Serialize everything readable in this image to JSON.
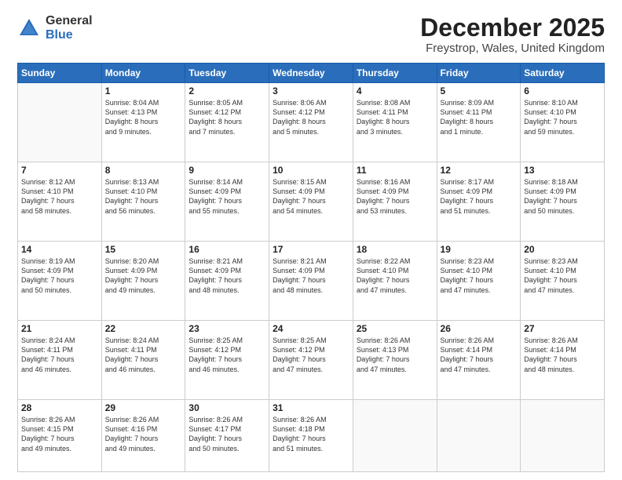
{
  "logo": {
    "general": "General",
    "blue": "Blue"
  },
  "header": {
    "month": "December 2025",
    "location": "Freystrop, Wales, United Kingdom"
  },
  "weekdays": [
    "Sunday",
    "Monday",
    "Tuesday",
    "Wednesday",
    "Thursday",
    "Friday",
    "Saturday"
  ],
  "weeks": [
    [
      {
        "day": "",
        "info": ""
      },
      {
        "day": "1",
        "info": "Sunrise: 8:04 AM\nSunset: 4:13 PM\nDaylight: 8 hours\nand 9 minutes."
      },
      {
        "day": "2",
        "info": "Sunrise: 8:05 AM\nSunset: 4:12 PM\nDaylight: 8 hours\nand 7 minutes."
      },
      {
        "day": "3",
        "info": "Sunrise: 8:06 AM\nSunset: 4:12 PM\nDaylight: 8 hours\nand 5 minutes."
      },
      {
        "day": "4",
        "info": "Sunrise: 8:08 AM\nSunset: 4:11 PM\nDaylight: 8 hours\nand 3 minutes."
      },
      {
        "day": "5",
        "info": "Sunrise: 8:09 AM\nSunset: 4:11 PM\nDaylight: 8 hours\nand 1 minute."
      },
      {
        "day": "6",
        "info": "Sunrise: 8:10 AM\nSunset: 4:10 PM\nDaylight: 7 hours\nand 59 minutes."
      }
    ],
    [
      {
        "day": "7",
        "info": "Sunrise: 8:12 AM\nSunset: 4:10 PM\nDaylight: 7 hours\nand 58 minutes."
      },
      {
        "day": "8",
        "info": "Sunrise: 8:13 AM\nSunset: 4:10 PM\nDaylight: 7 hours\nand 56 minutes."
      },
      {
        "day": "9",
        "info": "Sunrise: 8:14 AM\nSunset: 4:09 PM\nDaylight: 7 hours\nand 55 minutes."
      },
      {
        "day": "10",
        "info": "Sunrise: 8:15 AM\nSunset: 4:09 PM\nDaylight: 7 hours\nand 54 minutes."
      },
      {
        "day": "11",
        "info": "Sunrise: 8:16 AM\nSunset: 4:09 PM\nDaylight: 7 hours\nand 53 minutes."
      },
      {
        "day": "12",
        "info": "Sunrise: 8:17 AM\nSunset: 4:09 PM\nDaylight: 7 hours\nand 51 minutes."
      },
      {
        "day": "13",
        "info": "Sunrise: 8:18 AM\nSunset: 4:09 PM\nDaylight: 7 hours\nand 50 minutes."
      }
    ],
    [
      {
        "day": "14",
        "info": "Sunrise: 8:19 AM\nSunset: 4:09 PM\nDaylight: 7 hours\nand 50 minutes."
      },
      {
        "day": "15",
        "info": "Sunrise: 8:20 AM\nSunset: 4:09 PM\nDaylight: 7 hours\nand 49 minutes."
      },
      {
        "day": "16",
        "info": "Sunrise: 8:21 AM\nSunset: 4:09 PM\nDaylight: 7 hours\nand 48 minutes."
      },
      {
        "day": "17",
        "info": "Sunrise: 8:21 AM\nSunset: 4:09 PM\nDaylight: 7 hours\nand 48 minutes."
      },
      {
        "day": "18",
        "info": "Sunrise: 8:22 AM\nSunset: 4:10 PM\nDaylight: 7 hours\nand 47 minutes."
      },
      {
        "day": "19",
        "info": "Sunrise: 8:23 AM\nSunset: 4:10 PM\nDaylight: 7 hours\nand 47 minutes."
      },
      {
        "day": "20",
        "info": "Sunrise: 8:23 AM\nSunset: 4:10 PM\nDaylight: 7 hours\nand 47 minutes."
      }
    ],
    [
      {
        "day": "21",
        "info": "Sunrise: 8:24 AM\nSunset: 4:11 PM\nDaylight: 7 hours\nand 46 minutes."
      },
      {
        "day": "22",
        "info": "Sunrise: 8:24 AM\nSunset: 4:11 PM\nDaylight: 7 hours\nand 46 minutes."
      },
      {
        "day": "23",
        "info": "Sunrise: 8:25 AM\nSunset: 4:12 PM\nDaylight: 7 hours\nand 46 minutes."
      },
      {
        "day": "24",
        "info": "Sunrise: 8:25 AM\nSunset: 4:12 PM\nDaylight: 7 hours\nand 47 minutes."
      },
      {
        "day": "25",
        "info": "Sunrise: 8:26 AM\nSunset: 4:13 PM\nDaylight: 7 hours\nand 47 minutes."
      },
      {
        "day": "26",
        "info": "Sunrise: 8:26 AM\nSunset: 4:14 PM\nDaylight: 7 hours\nand 47 minutes."
      },
      {
        "day": "27",
        "info": "Sunrise: 8:26 AM\nSunset: 4:14 PM\nDaylight: 7 hours\nand 48 minutes."
      }
    ],
    [
      {
        "day": "28",
        "info": "Sunrise: 8:26 AM\nSunset: 4:15 PM\nDaylight: 7 hours\nand 49 minutes."
      },
      {
        "day": "29",
        "info": "Sunrise: 8:26 AM\nSunset: 4:16 PM\nDaylight: 7 hours\nand 49 minutes."
      },
      {
        "day": "30",
        "info": "Sunrise: 8:26 AM\nSunset: 4:17 PM\nDaylight: 7 hours\nand 50 minutes."
      },
      {
        "day": "31",
        "info": "Sunrise: 8:26 AM\nSunset: 4:18 PM\nDaylight: 7 hours\nand 51 minutes."
      },
      {
        "day": "",
        "info": ""
      },
      {
        "day": "",
        "info": ""
      },
      {
        "day": "",
        "info": ""
      }
    ]
  ]
}
